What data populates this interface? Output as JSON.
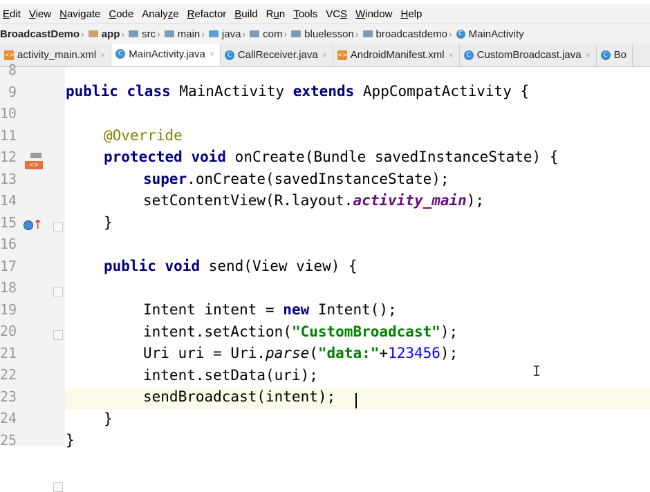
{
  "menu": {
    "items": [
      {
        "u": "E",
        "rest": "dit"
      },
      {
        "u": "V",
        "rest": "iew"
      },
      {
        "u": "N",
        "rest": "avigate"
      },
      {
        "u": "C",
        "rest": "ode"
      },
      {
        "pre": "Analy",
        "u": "z",
        "rest": "e"
      },
      {
        "u": "R",
        "rest": "efactor"
      },
      {
        "u": "B",
        "rest": "uild"
      },
      {
        "pre": "R",
        "u": "u",
        "rest": "n"
      },
      {
        "u": "T",
        "rest": "ools"
      },
      {
        "pre": "VC",
        "u": "S",
        "rest": ""
      },
      {
        "u": "W",
        "rest": "indow"
      },
      {
        "u": "H",
        "rest": "elp"
      }
    ]
  },
  "breadcrumb": {
    "project": "BroadcastDemo",
    "items": [
      "app",
      "src",
      "main",
      "java",
      "com",
      "bluelesson",
      "broadcastdemo",
      "MainActivity"
    ]
  },
  "tabs": [
    {
      "label": "activity_main.xml",
      "icon": "xml-file-icon"
    },
    {
      "label": "MainActivity.java",
      "icon": "class-icon",
      "active": true
    },
    {
      "label": "CallReceiver.java",
      "icon": "class-icon"
    },
    {
      "label": "AndroidManifest.xml",
      "icon": "manifest-icon"
    },
    {
      "label": "CustomBroadcast.java",
      "icon": "class-icon"
    },
    {
      "label": "Bo",
      "icon": "class-icon"
    }
  ],
  "editor": {
    "line_numbers": [
      "8",
      "9",
      "10",
      "11",
      "12",
      "13",
      "14",
      "15",
      "16",
      "17",
      "18",
      "19",
      "20",
      "21",
      "22",
      "23",
      "24",
      "25"
    ],
    "code": {
      "l9": {
        "k1": "public",
        "k2": "class",
        "name": " MainActivity ",
        "k3": "extends",
        "rest": " AppCompatActivity {"
      },
      "l11": "@Override",
      "l12": {
        "k1": "protected",
        "k2": "void",
        "rest": " onCreate(Bundle savedInstanceState) {"
      },
      "l13": {
        "k1": "super",
        "rest": ".onCreate(savedInstanceState);"
      },
      "l14": {
        "pre": "setContentView(R.layout.",
        "field": "activity_main",
        "post": ");"
      },
      "l15": "}",
      "l17": {
        "k1": "public",
        "k2": "void",
        "rest": " send(View view) {"
      },
      "l19": {
        "pre": "Intent intent = ",
        "k1": "new",
        "post": " Intent();"
      },
      "l20": {
        "pre": "intent.setAction(",
        "str": "\"CustomBroadcast\"",
        "post": ");"
      },
      "l21": {
        "pre": "Uri uri = Uri.",
        "it": "parse",
        "mid": "(",
        "str": "\"data:\"",
        "plus": "+",
        "num": "123456",
        "post": ");"
      },
      "l22": "intent.setData(uri);",
      "l23": "sendBroadcast(intent);",
      "l24": "}",
      "l25": "}"
    }
  },
  "cursor_glyph": "I"
}
